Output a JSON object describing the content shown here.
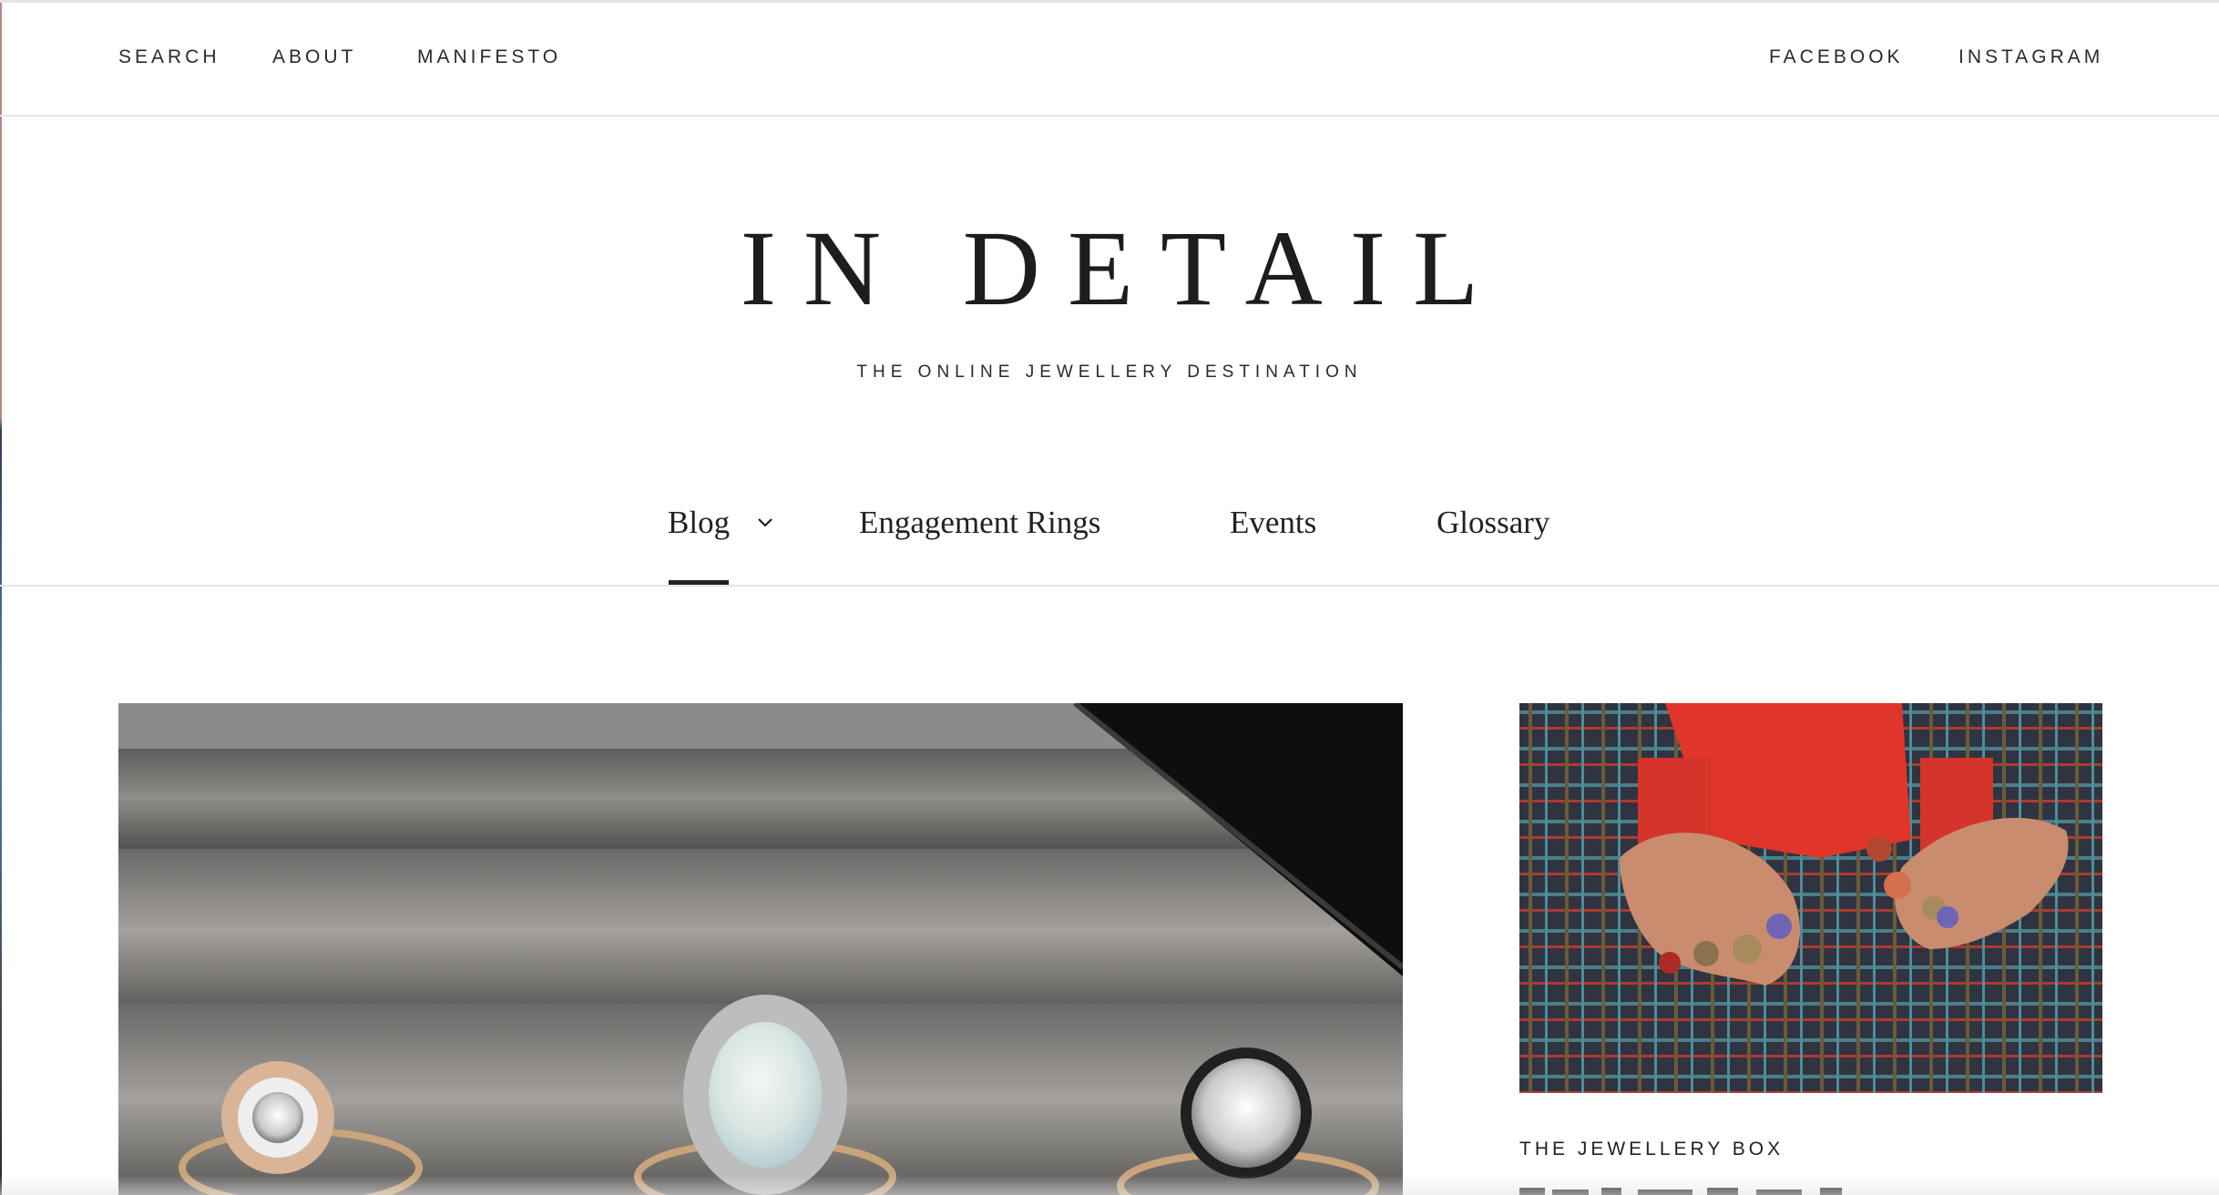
{
  "topbar": {
    "left_links": [
      "SEARCH",
      "ABOUT",
      "MANIFESTO"
    ],
    "right_links": [
      "FACEBOOK",
      "INSTAGRAM"
    ]
  },
  "masthead": {
    "logo": "IN DETAIL",
    "tagline": "THE ONLINE JEWELLERY DESTINATION"
  },
  "nav": {
    "items": [
      "Blog",
      "Engagement Rings",
      "Events",
      "Glossary"
    ],
    "active": "Blog"
  },
  "featured": {
    "side_category": "THE JEWELLERY BOX"
  },
  "icons": {
    "dropdown": "chevron-down-icon"
  },
  "colors": {
    "text": "#1f1f1f",
    "divider": "#e6e6e6",
    "background": "#ffffff"
  }
}
